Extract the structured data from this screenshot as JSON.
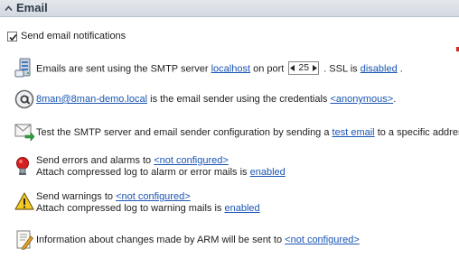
{
  "section": {
    "title": "Email"
  },
  "notifications": {
    "checkbox_label": "Send email notifications",
    "checked": true
  },
  "smtp": {
    "prefix": "Emails are sent using the SMTP server",
    "server": "localhost",
    "port_label": "on port",
    "port": "25",
    "ssl_label": ". SSL is",
    "ssl_value": "disabled",
    "suffix": "."
  },
  "sender": {
    "address": "8man@8man-demo.local",
    "middle": "is the email sender using the credentials",
    "credentials": "<anonymous>",
    "suffix": "."
  },
  "test": {
    "prefix": "Test the SMTP server and email sender configuration by sending a",
    "link": "test email",
    "suffix": "to a specific address."
  },
  "errors": {
    "line1_prefix": "Send errors and alarms to",
    "line1_link": "<not configured>",
    "line2_prefix": "Attach compressed log to alarm or error mails is",
    "line2_link": "enabled"
  },
  "warnings": {
    "line1_prefix": "Send warnings to",
    "line1_link": "<not configured>",
    "line2_prefix": "Attach compressed log to warning mails is",
    "line2_link": "enabled"
  },
  "changes": {
    "prefix": "Information about changes made by ARM will be sent to",
    "link": "<not configured>"
  },
  "icons": {
    "collapse": "chevron-up-icon",
    "server": "server-icon",
    "sender": "at-sign-icon",
    "test": "send-mail-icon",
    "errors": "alarm-icon",
    "warnings": "warning-icon",
    "changes": "document-pen-icon"
  },
  "colors": {
    "link": "#1a55b4",
    "header_bg": "#d9dee4",
    "alarm": "#d62020",
    "warning": "#f3c928"
  }
}
